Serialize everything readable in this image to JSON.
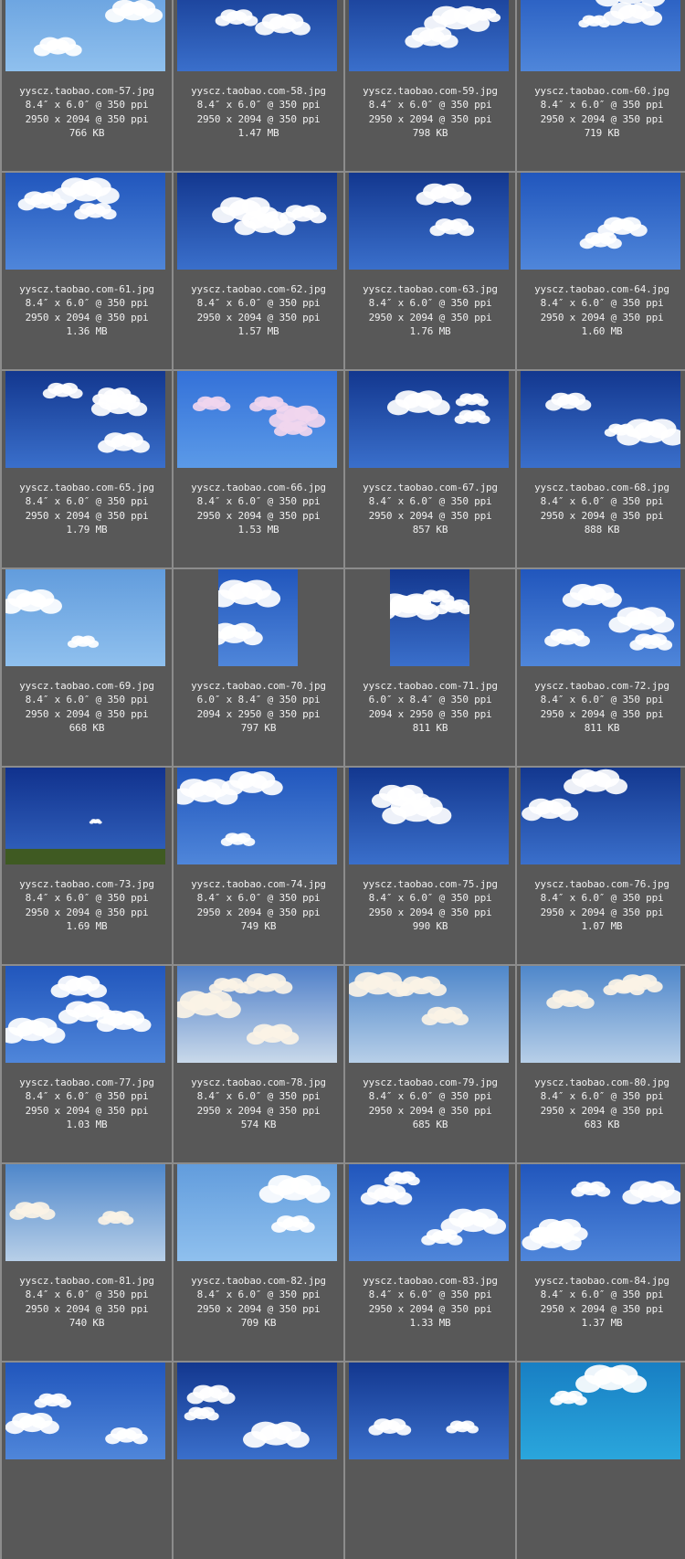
{
  "thumbnails": [
    {
      "filename": "yyscz.taobao.com-57.jpg",
      "print_size": "8.4″ x 6.0″ @ 350 ppi",
      "pixels": "2950 x 2094 @ 350 ppi",
      "file_size": "766 KB",
      "orientation": "landscape",
      "palette": "bright"
    },
    {
      "filename": "yyscz.taobao.com-58.jpg",
      "print_size": "8.4″ x 6.0″ @ 350 ppi",
      "pixels": "2950 x 2094 @ 350 ppi",
      "file_size": "1.47 MB",
      "orientation": "landscape",
      "palette": "deep"
    },
    {
      "filename": "yyscz.taobao.com-59.jpg",
      "print_size": "8.4″ x 6.0″ @ 350 ppi",
      "pixels": "2950 x 2094 @ 350 ppi",
      "file_size": "798 KB",
      "orientation": "landscape",
      "palette": "deep"
    },
    {
      "filename": "yyscz.taobao.com-60.jpg",
      "print_size": "8.4″ x 6.0″ @ 350 ppi",
      "pixels": "2950 x 2094 @ 350 ppi",
      "file_size": "719 KB",
      "orientation": "landscape",
      "palette": "vivid"
    },
    {
      "filename": "yyscz.taobao.com-61.jpg",
      "print_size": "8.4″ x 6.0″ @ 350 ppi",
      "pixels": "2950 x 2094 @ 350 ppi",
      "file_size": "1.36 MB",
      "orientation": "landscape",
      "palette": "vivid"
    },
    {
      "filename": "yyscz.taobao.com-62.jpg",
      "print_size": "8.4″ x 6.0″ @ 350 ppi",
      "pixels": "2950 x 2094 @ 350 ppi",
      "file_size": "1.57 MB",
      "orientation": "landscape",
      "palette": "deep"
    },
    {
      "filename": "yyscz.taobao.com-63.jpg",
      "print_size": "8.4″ x 6.0″ @ 350 ppi",
      "pixels": "2950 x 2094 @ 350 ppi",
      "file_size": "1.76 MB",
      "orientation": "landscape",
      "palette": "deep"
    },
    {
      "filename": "yyscz.taobao.com-64.jpg",
      "print_size": "8.4″ x 6.0″ @ 350 ppi",
      "pixels": "2950 x 2094 @ 350 ppi",
      "file_size": "1.60 MB",
      "orientation": "landscape",
      "palette": "vivid"
    },
    {
      "filename": "yyscz.taobao.com-65.jpg",
      "print_size": "8.4″ x 6.0″ @ 350 ppi",
      "pixels": "2950 x 2094 @ 350 ppi",
      "file_size": "1.79 MB",
      "orientation": "landscape",
      "palette": "deep"
    },
    {
      "filename": "yyscz.taobao.com-66.jpg",
      "print_size": "8.4″ x 6.0″ @ 350 ppi",
      "pixels": "2950 x 2094 @ 350 ppi",
      "file_size": "1.53 MB",
      "orientation": "landscape",
      "palette": "pink"
    },
    {
      "filename": "yyscz.taobao.com-67.jpg",
      "print_size": "8.4″ x 6.0″ @ 350 ppi",
      "pixels": "2950 x 2094 @ 350 ppi",
      "file_size": "857 KB",
      "orientation": "landscape",
      "palette": "deep"
    },
    {
      "filename": "yyscz.taobao.com-68.jpg",
      "print_size": "8.4″ x 6.0″ @ 350 ppi",
      "pixels": "2950 x 2094 @ 350 ppi",
      "file_size": "888 KB",
      "orientation": "landscape",
      "palette": "deep"
    },
    {
      "filename": "yyscz.taobao.com-69.jpg",
      "print_size": "8.4″ x 6.0″ @ 350 ppi",
      "pixels": "2950 x 2094 @ 350 ppi",
      "file_size": "668 KB",
      "orientation": "landscape",
      "palette": "bright"
    },
    {
      "filename": "yyscz.taobao.com-70.jpg",
      "print_size": "6.0″ x 8.4″ @ 350 ppi",
      "pixels": "2094 x 2950 @ 350 ppi",
      "file_size": "797 KB",
      "orientation": "portrait",
      "palette": "vivid"
    },
    {
      "filename": "yyscz.taobao.com-71.jpg",
      "print_size": "6.0″ x 8.4″ @ 350 ppi",
      "pixels": "2094 x 2950 @ 350 ppi",
      "file_size": "811 KB",
      "orientation": "portrait",
      "palette": "deep"
    },
    {
      "filename": "yyscz.taobao.com-72.jpg",
      "print_size": "8.4″ x 6.0″ @ 350 ppi",
      "pixels": "2950 x 2094 @ 350 ppi",
      "file_size": "811 KB",
      "orientation": "landscape",
      "palette": "vivid"
    },
    {
      "filename": "yyscz.taobao.com-73.jpg",
      "print_size": "8.4″ x 6.0″ @ 350 ppi",
      "pixels": "2950 x 2094 @ 350 ppi",
      "file_size": "1.69 MB",
      "orientation": "landscape",
      "palette": "field"
    },
    {
      "filename": "yyscz.taobao.com-74.jpg",
      "print_size": "8.4″ x 6.0″ @ 350 ppi",
      "pixels": "2950 x 2094 @ 350 ppi",
      "file_size": "749 KB",
      "orientation": "landscape",
      "palette": "vivid"
    },
    {
      "filename": "yyscz.taobao.com-75.jpg",
      "print_size": "8.4″ x 6.0″ @ 350 ppi",
      "pixels": "2950 x 2094 @ 350 ppi",
      "file_size": "990 KB",
      "orientation": "landscape",
      "palette": "deep"
    },
    {
      "filename": "yyscz.taobao.com-76.jpg",
      "print_size": "8.4″ x 6.0″ @ 350 ppi",
      "pixels": "2950 x 2094 @ 350 ppi",
      "file_size": "1.07 MB",
      "orientation": "landscape",
      "palette": "deep"
    },
    {
      "filename": "yyscz.taobao.com-77.jpg",
      "print_size": "8.4″ x 6.0″ @ 350 ppi",
      "pixels": "2950 x 2094 @ 350 ppi",
      "file_size": "1.03 MB",
      "orientation": "landscape",
      "palette": "vivid"
    },
    {
      "filename": "yyscz.taobao.com-78.jpg",
      "print_size": "8.4″ x 6.0″ @ 350 ppi",
      "pixels": "2950 x 2094 @ 350 ppi",
      "file_size": "574 KB",
      "orientation": "landscape",
      "palette": "hazy"
    },
    {
      "filename": "yyscz.taobao.com-79.jpg",
      "print_size": "8.4″ x 6.0″ @ 350 ppi",
      "pixels": "2950 x 2094 @ 350 ppi",
      "file_size": "685 KB",
      "orientation": "landscape",
      "palette": "soft"
    },
    {
      "filename": "yyscz.taobao.com-80.jpg",
      "print_size": "8.4″ x 6.0″ @ 350 ppi",
      "pixels": "2950 x 2094 @ 350 ppi",
      "file_size": "683 KB",
      "orientation": "landscape",
      "palette": "soft"
    },
    {
      "filename": "yyscz.taobao.com-81.jpg",
      "print_size": "8.4″ x 6.0″ @ 350 ppi",
      "pixels": "2950 x 2094 @ 350 ppi",
      "file_size": "740 KB",
      "orientation": "landscape",
      "palette": "soft"
    },
    {
      "filename": "yyscz.taobao.com-82.jpg",
      "print_size": "8.4″ x 6.0″ @ 350 ppi",
      "pixels": "2950 x 2094 @ 350 ppi",
      "file_size": "709 KB",
      "orientation": "landscape",
      "palette": "bright"
    },
    {
      "filename": "yyscz.taobao.com-83.jpg",
      "print_size": "8.4″ x 6.0″ @ 350 ppi",
      "pixels": "2950 x 2094 @ 350 ppi",
      "file_size": "1.33 MB",
      "orientation": "landscape",
      "palette": "vivid"
    },
    {
      "filename": "yyscz.taobao.com-84.jpg",
      "print_size": "8.4″ x 6.0″ @ 350 ppi",
      "pixels": "2950 x 2094 @ 350 ppi",
      "file_size": "1.37 MB",
      "orientation": "landscape",
      "palette": "vivid"
    },
    {
      "filename": "",
      "print_size": "",
      "pixels": "",
      "file_size": "",
      "orientation": "landscape",
      "palette": "vivid"
    },
    {
      "filename": "",
      "print_size": "",
      "pixels": "",
      "file_size": "",
      "orientation": "landscape",
      "palette": "deep"
    },
    {
      "filename": "",
      "print_size": "",
      "pixels": "",
      "file_size": "",
      "orientation": "landscape",
      "palette": "deep"
    },
    {
      "filename": "",
      "print_size": "",
      "pixels": "",
      "file_size": "",
      "orientation": "landscape",
      "palette": "teal"
    }
  ],
  "colors": {
    "background": "#8c8c8c",
    "cell": "#585858",
    "text": "#f0f0f0",
    "palettes": {
      "bright": [
        "#5b97da",
        "#8fc0ee"
      ],
      "deep": [
        "#0d2f86",
        "#3a6fcb"
      ],
      "vivid": [
        "#1a4fb8",
        "#4f86da"
      ],
      "pink": [
        "#2e6bd6",
        "#5b9ae8"
      ],
      "field": [
        "#0b2a86",
        "#3465c0"
      ],
      "hazy": [
        "#3d72c4",
        "#c9d9ea"
      ],
      "soft": [
        "#3f7cc6",
        "#b7cfe8"
      ],
      "teal": [
        "#1579c0",
        "#2aa6dc"
      ]
    }
  }
}
